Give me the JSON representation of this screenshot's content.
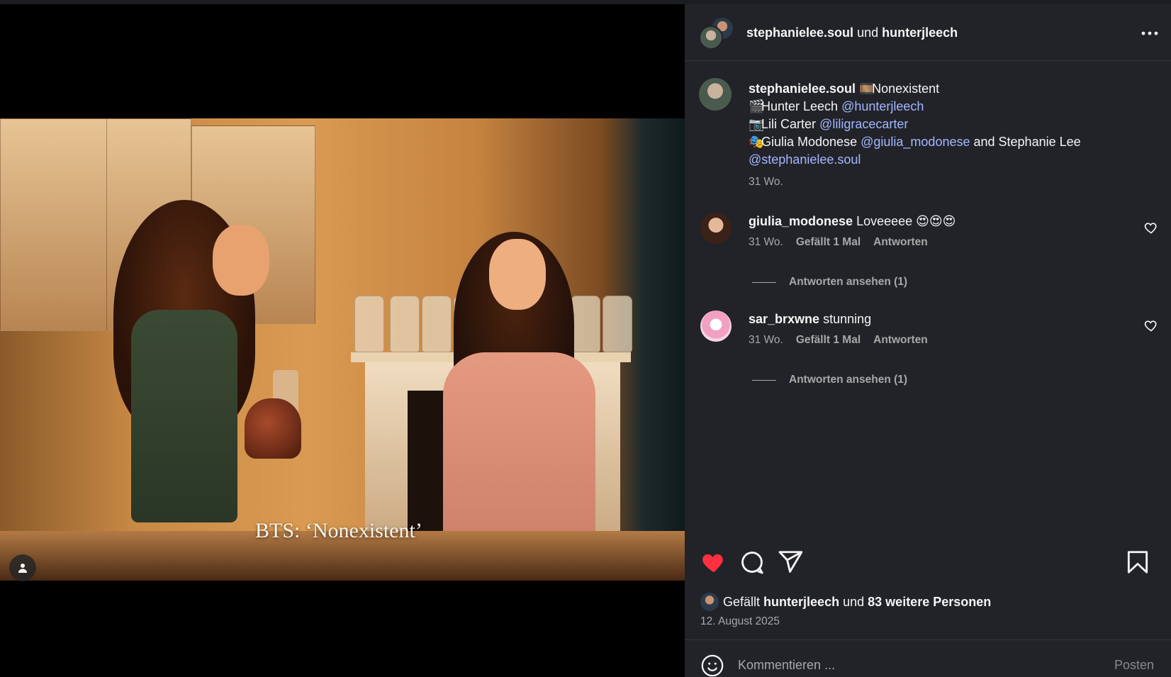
{
  "header": {
    "user1": "stephanielee.soul",
    "connector": "und",
    "user2": "hunterjleech"
  },
  "media": {
    "caption_overlay": "BTS: ‘Nonexistent’"
  },
  "post_caption": {
    "author": "stephanielee.soul",
    "line1_emoji": "🎞️",
    "line1_text": "Nonexistent",
    "line2_emoji": "🎬",
    "line2_text": "Hunter Leech",
    "line2_mention": "@hunterjleech",
    "line3_emoji": "📷",
    "line3_text": "Lili Carter",
    "line3_mention": "@liligracecarter",
    "line4_emoji": "🎭",
    "line4_text": "Giulia Modonese",
    "line4_mention": "@giulia_modonese",
    "line4_and": "and Stephanie Lee",
    "line5_mention": "@stephanielee.soul",
    "time": "31 Wo."
  },
  "comments": [
    {
      "user": "giulia_modonese",
      "text": "Loveeeee 😍😍😍",
      "time": "31 Wo.",
      "likes": "Gefällt 1 Mal",
      "reply": "Antworten",
      "view_replies": "Antworten ansehen (1)"
    },
    {
      "user": "sar_brxwne",
      "text": "stunning",
      "time": "31 Wo.",
      "likes": "Gefällt 1 Mal",
      "reply": "Antworten",
      "view_replies": "Antworten ansehen (1)"
    }
  ],
  "likes_line": {
    "prefix": "Gefällt",
    "user": "hunterjleech",
    "connector": "und",
    "others": "83 weitere Personen"
  },
  "date": "12. August 2025",
  "composer": {
    "placeholder": "Kommentieren ...",
    "post_label": "Posten"
  },
  "icons": {
    "like": "heart-filled-icon",
    "comment": "comment-icon",
    "share": "send-icon",
    "save": "bookmark-icon",
    "emoji": "smiley-icon",
    "more": "more-horizontal-icon",
    "tag": "user-tag-icon"
  },
  "colors": {
    "panel_bg": "#212328",
    "like_red": "#ff3040",
    "mention_blue": "#a3b7ff",
    "muted_text": "#a8a8a8"
  }
}
